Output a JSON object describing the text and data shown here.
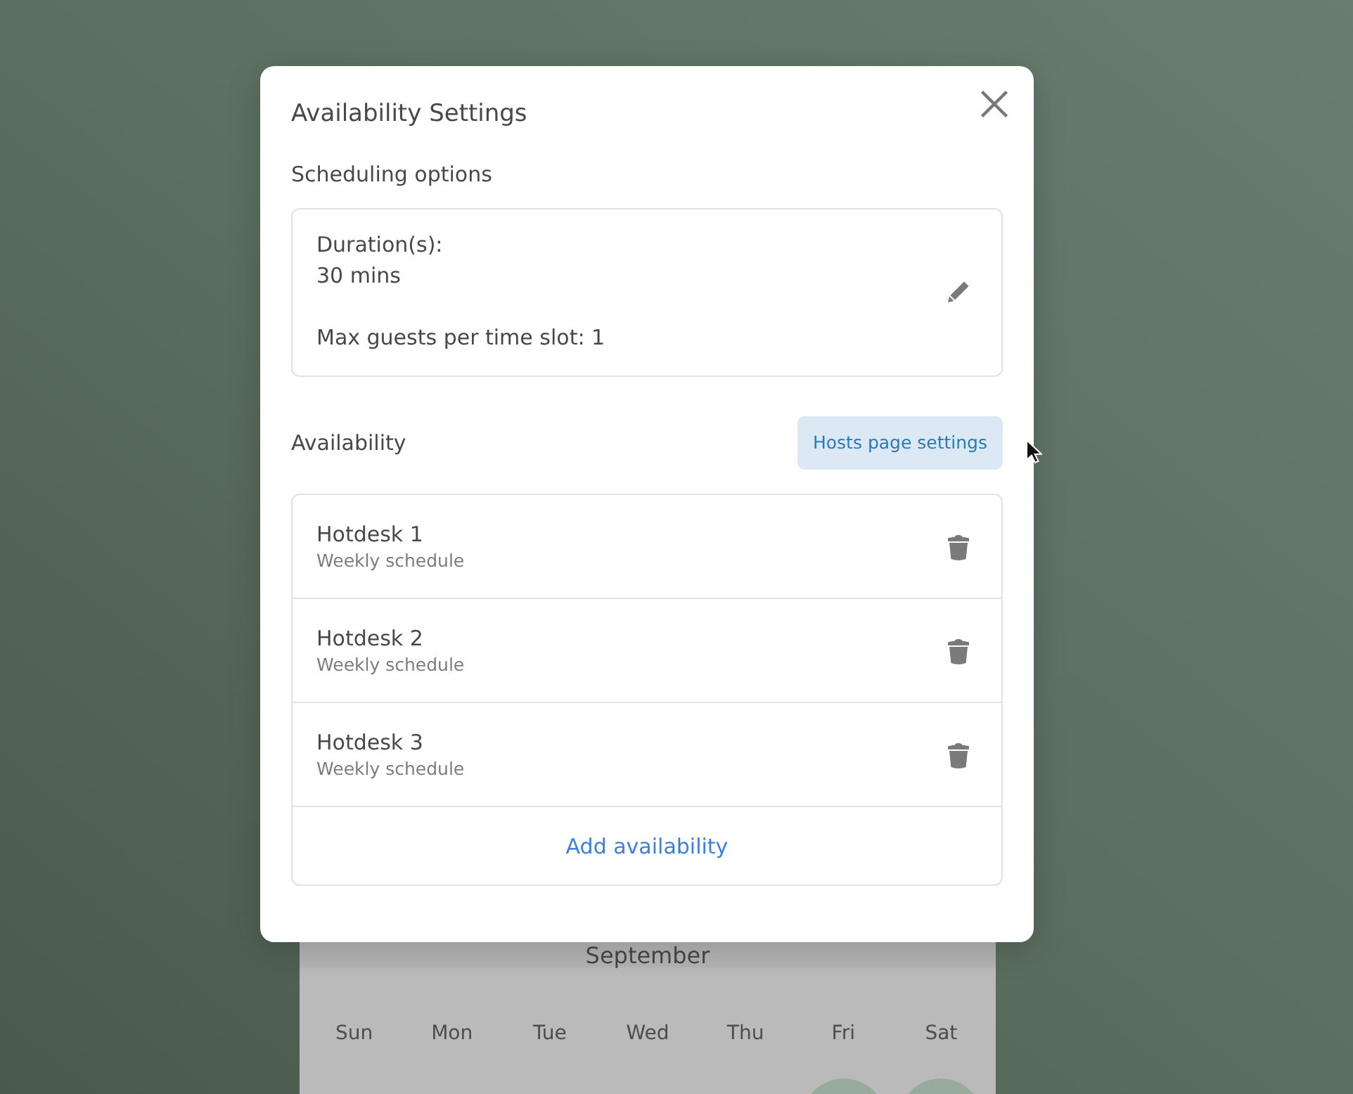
{
  "background_calendar": {
    "month": "September",
    "weekdays": [
      {
        "label": "Sun",
        "marked": false
      },
      {
        "label": "Mon",
        "marked": false
      },
      {
        "label": "Tue",
        "marked": false
      },
      {
        "label": "Wed",
        "marked": false
      },
      {
        "label": "Thu",
        "marked": false
      },
      {
        "label": "Fri",
        "marked": true
      },
      {
        "label": "Sat",
        "marked": true
      }
    ]
  },
  "dialog": {
    "title": "Availability Settings",
    "scheduling_options": {
      "heading": "Scheduling options",
      "duration_label": "Duration(s):",
      "duration_value": "30 mins",
      "max_guests": "Max guests per time slot: 1"
    },
    "availability": {
      "heading": "Availability",
      "settings_button": "Hosts page settings",
      "items": [
        {
          "name": "Hotdesk 1",
          "subtitle": "Weekly schedule"
        },
        {
          "name": "Hotdesk 2",
          "subtitle": "Weekly schedule"
        },
        {
          "name": "Hotdesk 3",
          "subtitle": "Weekly schedule"
        }
      ],
      "add_link": "Add availability"
    }
  }
}
